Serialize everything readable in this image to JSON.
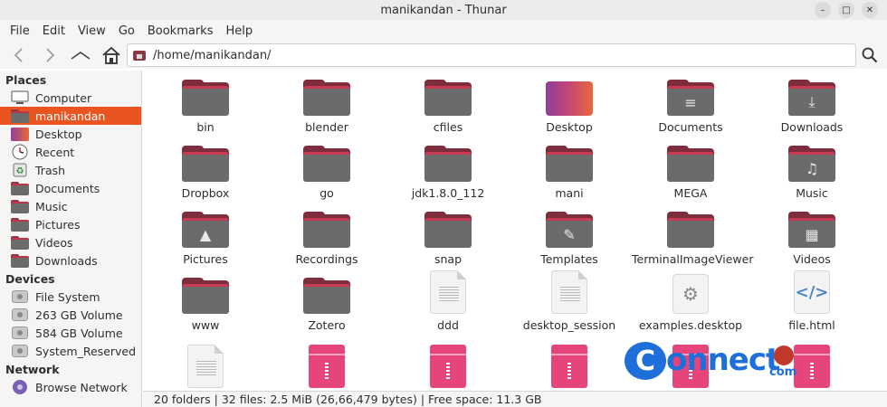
{
  "window": {
    "title": "manikandan - Thunar",
    "controls": [
      "minimize-icon",
      "maximize-icon",
      "close-icon"
    ]
  },
  "menu": [
    "File",
    "Edit",
    "View",
    "Go",
    "Bookmarks",
    "Help"
  ],
  "toolbar": {
    "location": "/home/manikandan/"
  },
  "sidebar": {
    "places_header": "Places",
    "places": [
      {
        "label": "Computer",
        "icon": "computer-icon"
      },
      {
        "label": "manikandan",
        "icon": "home-folder-icon",
        "active": true
      },
      {
        "label": "Desktop",
        "icon": "desktop-icon"
      },
      {
        "label": "Recent",
        "icon": "clock-icon"
      },
      {
        "label": "Trash",
        "icon": "trash-icon"
      },
      {
        "label": "Documents",
        "icon": "documents-folder-icon"
      },
      {
        "label": "Music",
        "icon": "music-folder-icon"
      },
      {
        "label": "Pictures",
        "icon": "pictures-folder-icon"
      },
      {
        "label": "Videos",
        "icon": "videos-folder-icon"
      },
      {
        "label": "Downloads",
        "icon": "downloads-folder-icon"
      }
    ],
    "devices_header": "Devices",
    "devices": [
      {
        "label": "File System",
        "icon": "drive-icon"
      },
      {
        "label": "263 GB Volume",
        "icon": "drive-icon"
      },
      {
        "label": "584 GB Volume",
        "icon": "drive-icon"
      },
      {
        "label": "System_Reserved",
        "icon": "drive-icon"
      }
    ],
    "network_header": "Network",
    "network": [
      {
        "label": "Browse Network",
        "icon": "network-icon"
      }
    ]
  },
  "files": [
    {
      "name": "bin",
      "type": "folder"
    },
    {
      "name": "blender",
      "type": "folder"
    },
    {
      "name": "cfiles",
      "type": "folder"
    },
    {
      "name": "Desktop",
      "type": "desktop-folder"
    },
    {
      "name": "Documents",
      "type": "folder",
      "emblem": "≡"
    },
    {
      "name": "Downloads",
      "type": "folder",
      "emblem": "⤓"
    },
    {
      "name": "Dropbox",
      "type": "folder"
    },
    {
      "name": "go",
      "type": "folder"
    },
    {
      "name": "jdk1.8.0_112",
      "type": "folder"
    },
    {
      "name": "mani",
      "type": "folder"
    },
    {
      "name": "MEGA",
      "type": "folder"
    },
    {
      "name": "Music",
      "type": "folder",
      "emblem": "♫"
    },
    {
      "name": "Pictures",
      "type": "folder",
      "emblem": "▲"
    },
    {
      "name": "Recordings",
      "type": "folder"
    },
    {
      "name": "snap",
      "type": "folder"
    },
    {
      "name": "Templates",
      "type": "folder",
      "emblem": "✎"
    },
    {
      "name": "TerminalImageViewer",
      "type": "folder"
    },
    {
      "name": "Videos",
      "type": "folder",
      "emblem": "▦"
    },
    {
      "name": "www",
      "type": "folder"
    },
    {
      "name": "Zotero",
      "type": "folder"
    },
    {
      "name": "ddd",
      "type": "document"
    },
    {
      "name": "desktop_session",
      "type": "document"
    },
    {
      "name": "examples.desktop",
      "type": "desktop-file"
    },
    {
      "name": "file.html",
      "type": "html-file"
    },
    {
      "name": "",
      "type": "document"
    },
    {
      "name": "",
      "type": "archive"
    },
    {
      "name": "",
      "type": "archive"
    },
    {
      "name": "",
      "type": "archive"
    },
    {
      "name": "",
      "type": "archive"
    },
    {
      "name": "",
      "type": "archive"
    }
  ],
  "status": "20 folders | 32 files: 2.5 MiB (26,66,479 bytes) | Free space: 11.3 GB",
  "watermark": {
    "brand": "onnect",
    "suffix": "com"
  }
}
